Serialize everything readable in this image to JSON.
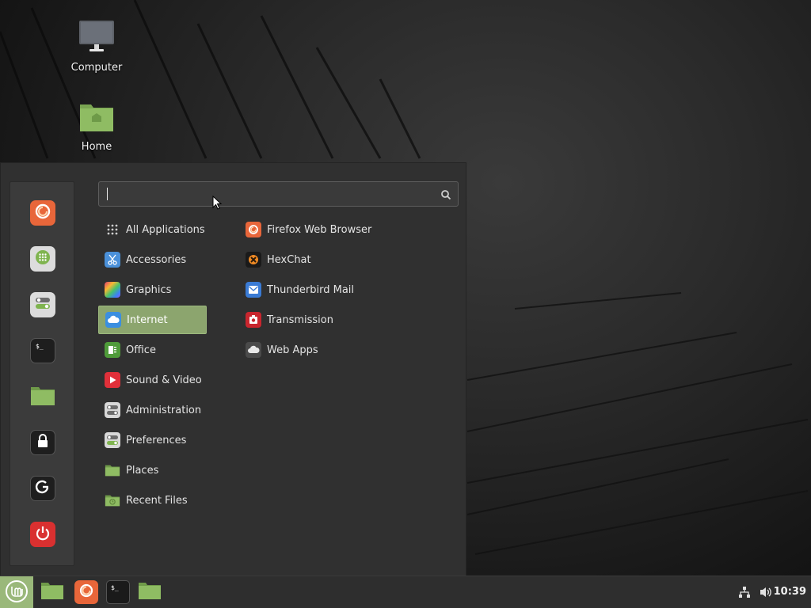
{
  "desktop": {
    "icons": [
      {
        "label": "Computer",
        "icon": "monitor-icon"
      },
      {
        "label": "Home",
        "icon": "home-folder-icon"
      }
    ]
  },
  "menu": {
    "search": {
      "value": "",
      "placeholder": ""
    },
    "favorites": [
      {
        "name": "firefox",
        "icon": "firefox-icon"
      },
      {
        "name": "software-manager",
        "icon": "software-manager-icon"
      },
      {
        "name": "system-settings",
        "icon": "settings-toggle-icon"
      },
      {
        "name": "terminal",
        "icon": "terminal-icon"
      },
      {
        "name": "files",
        "icon": "folder-icon"
      },
      {
        "name": "lock-screen",
        "icon": "lock-icon"
      },
      {
        "name": "log-out",
        "icon": "logout-icon"
      },
      {
        "name": "quit",
        "icon": "power-icon"
      }
    ],
    "categories": [
      {
        "label": "All Applications",
        "icon": "grid-icon"
      },
      {
        "label": "Accessories",
        "icon": "scissors-icon"
      },
      {
        "label": "Graphics",
        "icon": "palette-icon"
      },
      {
        "label": "Internet",
        "icon": "cloud-icon",
        "selected": true
      },
      {
        "label": "Office",
        "icon": "office-icon"
      },
      {
        "label": "Sound & Video",
        "icon": "play-icon"
      },
      {
        "label": "Administration",
        "icon": "admin-toggle-icon"
      },
      {
        "label": "Preferences",
        "icon": "preferences-toggle-icon"
      },
      {
        "label": "Places",
        "icon": "folder-icon"
      },
      {
        "label": "Recent Files",
        "icon": "recent-folder-icon"
      }
    ],
    "apps": [
      {
        "label": "Firefox Web Browser",
        "icon": "firefox-icon"
      },
      {
        "label": "HexChat",
        "icon": "hexchat-icon"
      },
      {
        "label": "Thunderbird Mail",
        "icon": "thunderbird-icon"
      },
      {
        "label": "Transmission",
        "icon": "transmission-icon"
      },
      {
        "label": "Web Apps",
        "icon": "web-apps-icon"
      }
    ]
  },
  "taskbar": {
    "pinned": [
      {
        "name": "show-desktop",
        "icon": "desktop-folder-icon"
      },
      {
        "name": "firefox",
        "icon": "firefox-icon"
      },
      {
        "name": "terminal",
        "icon": "terminal-icon"
      },
      {
        "name": "files",
        "icon": "folder-icon"
      }
    ],
    "tray": {
      "network": "network-icon",
      "volume": "volume-icon"
    },
    "clock": "10:39"
  },
  "colors": {
    "accent": "#8ca56e",
    "menu_bg": "#303030",
    "panel_bg": "#2e2e2e",
    "mint_green": "#9ab87a"
  }
}
